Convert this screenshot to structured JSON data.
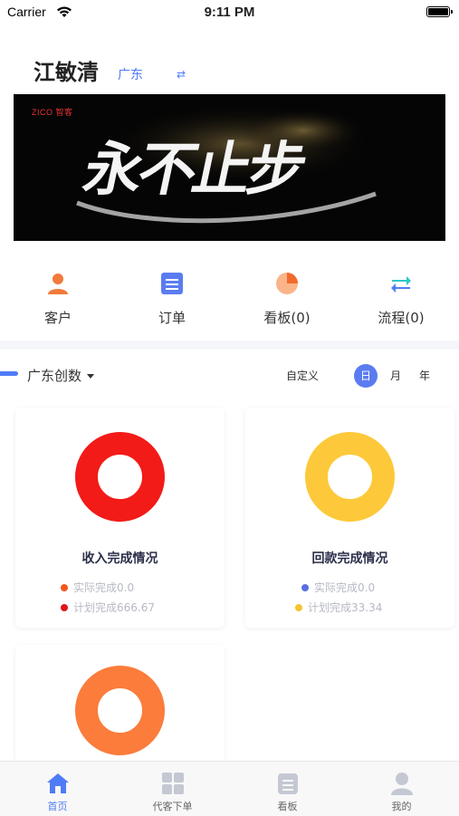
{
  "status_bar": {
    "carrier": "Carrier",
    "time": "9:11 PM"
  },
  "header": {
    "user_name": "江敏清",
    "region": "广东",
    "switch_icon": "swap-icon"
  },
  "banner": {
    "brand": "ZICO 智客",
    "slogan": "永不止步"
  },
  "quick_actions": [
    {
      "label": "客户",
      "icon": "customer-icon",
      "color": "#f27a3a"
    },
    {
      "label": "订单",
      "icon": "order-icon",
      "color": "#5b7cf0"
    },
    {
      "label": "看板(0)",
      "icon": "dashboard-icon",
      "color": "#f8894a"
    },
    {
      "label": "流程(0)",
      "icon": "flow-icon",
      "color": "#2ec7c9"
    }
  ],
  "filter": {
    "org": "广东创数",
    "custom": "自定义",
    "day": "日",
    "month": "月",
    "year": "年",
    "selected": "日"
  },
  "cards": [
    {
      "title": "收入完成情况",
      "ring_color": "#f21b18",
      "legend": [
        {
          "text": "实际完成0.0",
          "color": "#f0591e"
        },
        {
          "text": "计划完成666.67",
          "color": "#e0161b"
        }
      ]
    },
    {
      "title": "回款完成情况",
      "ring_color": "#fdc93a",
      "legend": [
        {
          "text": "实际完成0.0",
          "color": "#5b6fe0"
        },
        {
          "text": "计划完成33.34",
          "color": "#f6c42e"
        }
      ]
    },
    {
      "title": "",
      "ring_color": "#fb7c3b",
      "legend": []
    }
  ],
  "tab_bar": {
    "items": [
      {
        "label": "首页",
        "icon": "home-icon",
        "active": true
      },
      {
        "label": "代客下单",
        "icon": "grid-order-icon",
        "active": false
      },
      {
        "label": "看板",
        "icon": "board-icon",
        "active": false
      },
      {
        "label": "我的",
        "icon": "profile-icon",
        "active": false
      }
    ],
    "active_color": "#4f7cf6"
  }
}
